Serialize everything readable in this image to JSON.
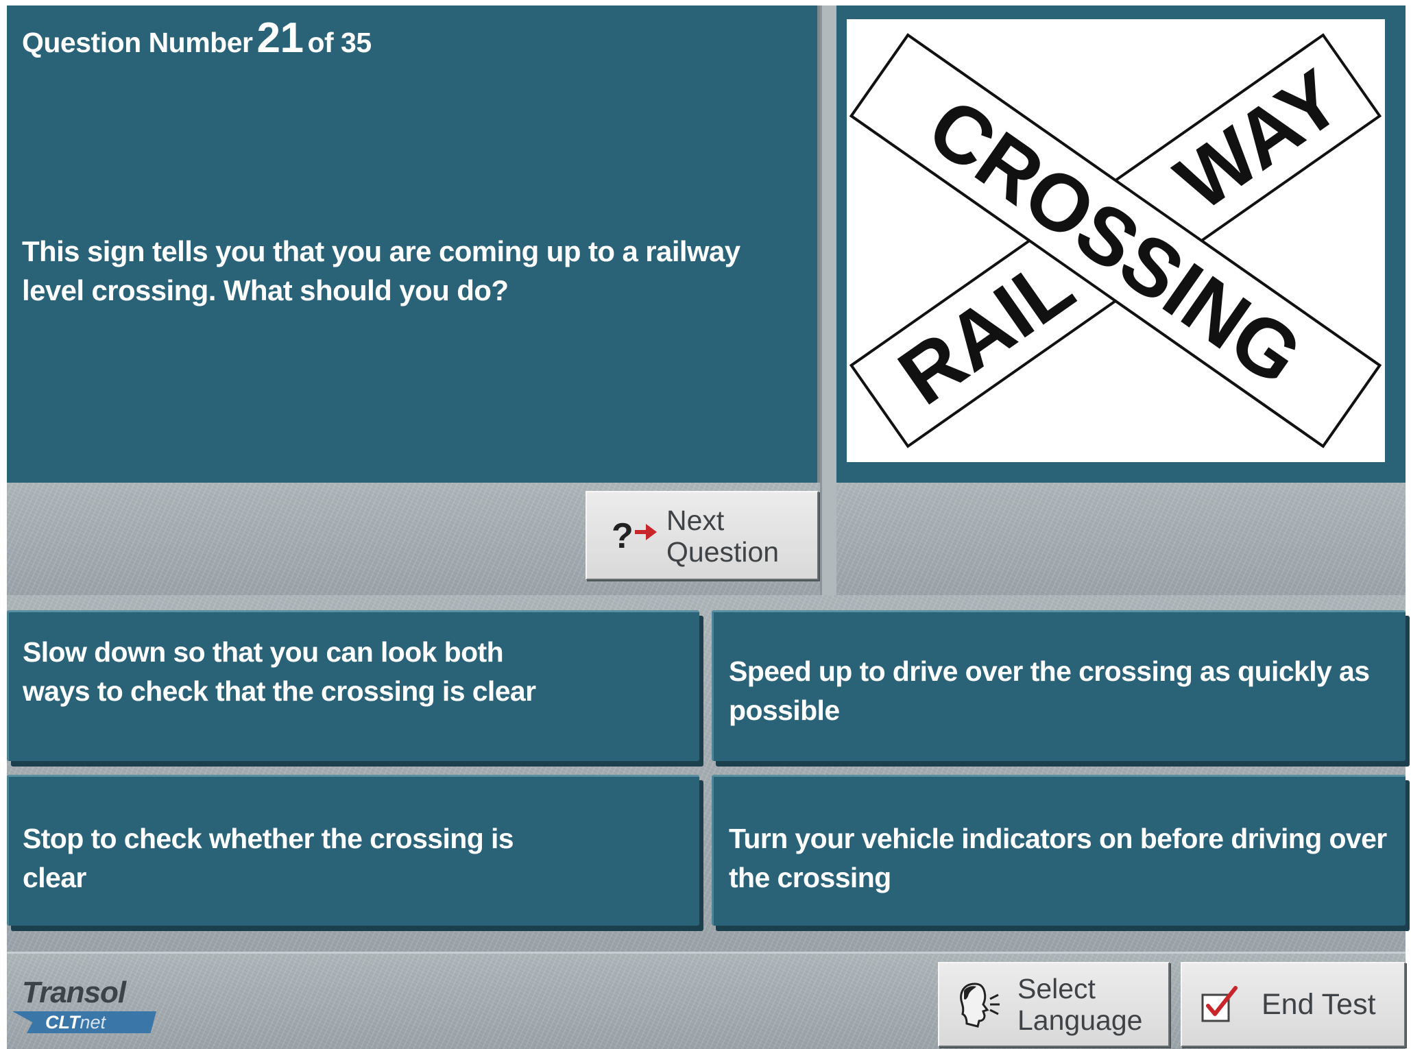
{
  "question": {
    "prefix": "Question Number",
    "number": "21",
    "suffix": "of 35",
    "text": "This sign tells you that you are coming up to a railway level crossing. What should you do?"
  },
  "sign": {
    "word1": "CROSSING",
    "word2": "RAIL",
    "word3": "WAY"
  },
  "next_button": {
    "icon": "question-next-icon",
    "line1": "Next",
    "line2": "Question"
  },
  "answers": [
    {
      "text": "Slow down so that you can look both ways to check that the crossing is clear"
    },
    {
      "text": "Speed up to drive over the crossing as quickly as possible"
    },
    {
      "text": "Stop to check whether the crossing is clear"
    },
    {
      "text": "Turn your vehicle indicators on before driving over the crossing"
    }
  ],
  "footer": {
    "logo_main": "Transol",
    "logo_sub": "CLT",
    "logo_sub2": "net",
    "language_button": {
      "icon": "speaking-head-icon",
      "line1": "Select",
      "line2": "Language"
    },
    "end_button": {
      "icon": "checkbox-check-icon",
      "label": "End Test"
    }
  },
  "colors": {
    "panel": "#2a6278",
    "metal": "#a3acb1",
    "accent_red": "#c8262b"
  }
}
